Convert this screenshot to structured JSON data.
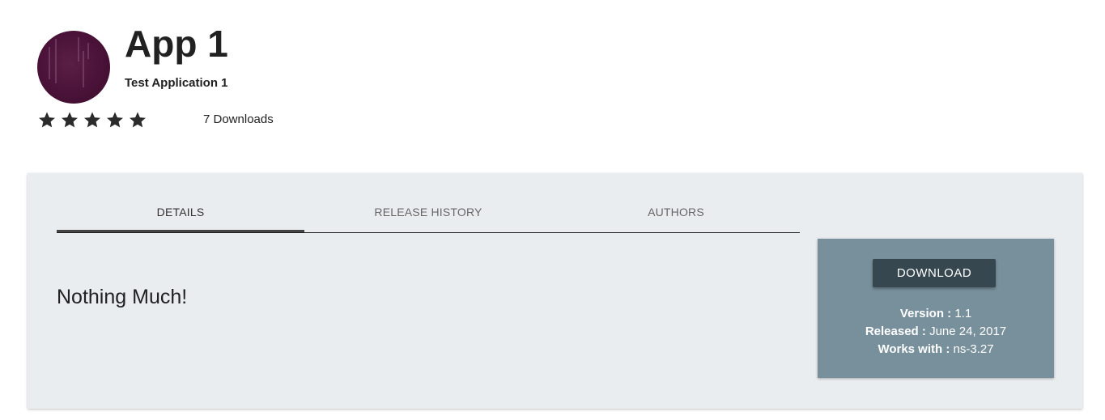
{
  "app": {
    "title": "App 1",
    "subtitle": "Test Application 1",
    "rating": 5,
    "rating_max": 5,
    "downloads": "7 Downloads"
  },
  "tabs": [
    {
      "label": "DETAILS",
      "active": true
    },
    {
      "label": "RELEASE HISTORY",
      "active": false
    },
    {
      "label": "AUTHORS",
      "active": false
    }
  ],
  "details": {
    "text": "Nothing Much!"
  },
  "release": {
    "download_label": "DOWNLOAD",
    "version_key": "Version :",
    "version_value": "1.1",
    "released_key": "Released :",
    "released_value": "June 24, 2017",
    "works_with_key": "Works with :",
    "works_with_value": "ns-3.27"
  },
  "colors": {
    "panel_bg": "#eaedf0",
    "card_bg": "#78909c",
    "button_bg": "#37474f",
    "text": "#212121"
  },
  "icons": {
    "logo": "app-logo-icon",
    "star": "star-icon"
  }
}
